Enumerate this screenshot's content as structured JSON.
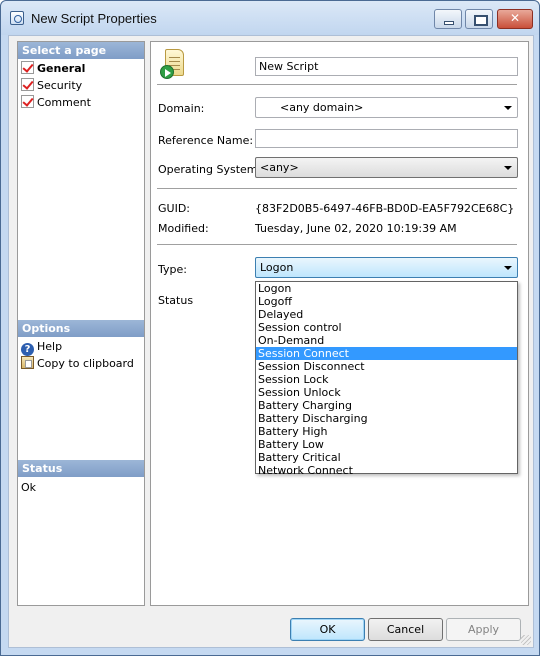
{
  "window": {
    "title": "New Script Properties"
  },
  "sidebar": {
    "select_header": "Select a page",
    "pages": [
      {
        "label": "General",
        "active": true
      },
      {
        "label": "Security",
        "active": false
      },
      {
        "label": "Comment",
        "active": false
      }
    ],
    "options_header": "Options",
    "options": [
      {
        "label": "Help",
        "icon": "help-icon"
      },
      {
        "label": "Copy to clipboard",
        "icon": "clipboard-icon"
      }
    ],
    "status_header": "Status",
    "status_value": "Ok"
  },
  "form": {
    "name_value": "New Script",
    "domain_label": "Domain:",
    "domain_value": "<any domain>",
    "reference_label": "Reference Name:",
    "reference_value": "",
    "os_label": "Operating System:",
    "os_value": "<any>",
    "guid_label": "GUID:",
    "guid_value": "{83F2D0B5-6497-46FB-BD0D-EA5F792CE68C}",
    "modified_label": "Modified:",
    "modified_value": "Tuesday, June 02, 2020 10:19:39 AM",
    "type_label": "Type:",
    "type_value": "Logon",
    "status_label": "Status",
    "type_options": [
      "Logon",
      "Logoff",
      "Delayed",
      "Session control",
      "On-Demand",
      "Session Connect",
      "Session Disconnect",
      "Session Lock",
      "Session Unlock",
      "Battery Charging",
      "Battery Discharging",
      "Battery High",
      "Battery Low",
      "Battery Critical",
      "Network Connect"
    ],
    "highlighted_option": "Session Connect"
  },
  "buttons": {
    "ok": "OK",
    "cancel": "Cancel",
    "apply": "Apply"
  },
  "colors": {
    "section_header": "#8ea9ce",
    "selection": "#3399ff",
    "accent_border": "#3c7fb1"
  }
}
